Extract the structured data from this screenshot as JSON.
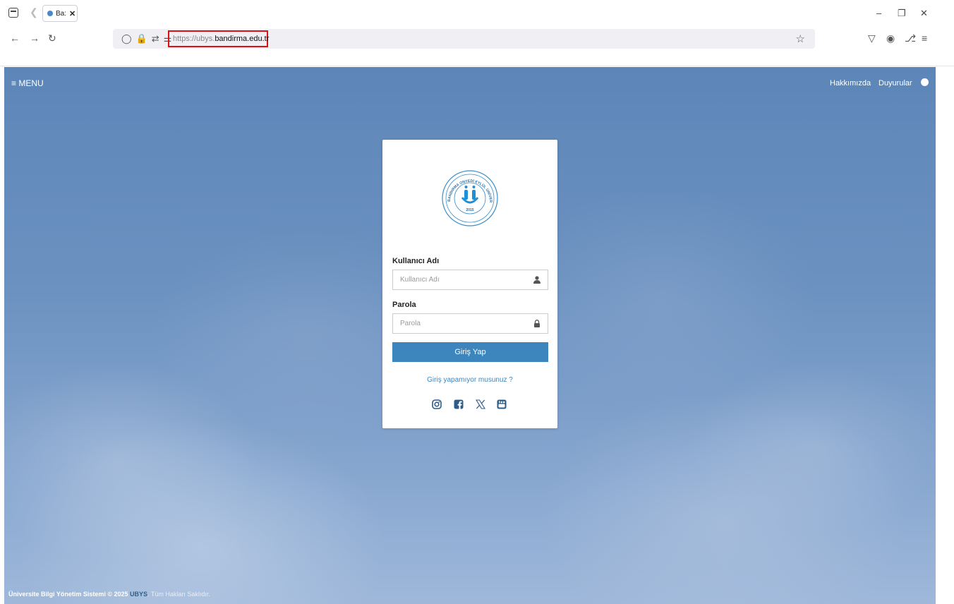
{
  "browser": {
    "tab_title": "Ba:",
    "url_protocol": "https://ubys.",
    "url_host": "bandirma.edu.tr"
  },
  "top_menu": {
    "menu_label": "MENU",
    "links": [
      "Hakkımızda",
      "Duyurular"
    ]
  },
  "logo": {
    "arc_text": "BANDIRMA ONYEDİ EYLÜL ÜNİVERSİTESİ",
    "year": "2015"
  },
  "login": {
    "username_label": "Kullanıcı Adı",
    "username_placeholder": "Kullanıcı Adı",
    "password_label": "Parola",
    "password_placeholder": "Parola",
    "submit_label": "Giriş Yap",
    "help_link": "Giriş yapamıyor musunuz ?"
  },
  "social": [
    "instagram-icon",
    "facebook-icon",
    "x-icon",
    "youtube-icon"
  ],
  "footer": {
    "text_bold": "Üniversite Bilgi Yönetim Sistemi © 2025",
    "brand": "UBYS",
    "rest": ". Tüm Hakları Saklıdır."
  },
  "colors": {
    "accent": "#3d86bd",
    "url_highlight": "#dd1111"
  }
}
